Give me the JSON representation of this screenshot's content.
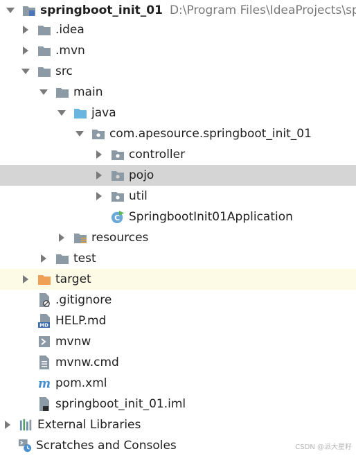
{
  "project": {
    "name": "springboot_init_01",
    "path": "D:\\Program Files\\IdeaProjects\\sp"
  },
  "tree": {
    "idea": ".idea",
    "mvn": ".mvn",
    "src": "src",
    "main": "main",
    "java": "java",
    "package": "com.apesource.springboot_init_01",
    "controller": "controller",
    "pojo": "pojo",
    "util": "util",
    "app_class": "SpringbootInit01Application",
    "resources": "resources",
    "test": "test",
    "target": "target",
    "gitignore": ".gitignore",
    "help": "HELP.md",
    "mvnw": "mvnw",
    "mvnw_cmd": "mvnw.cmd",
    "pom": "pom.xml",
    "iml": "springboot_init_01.iml",
    "external_libraries": "External Libraries",
    "scratches": "Scratches and Consoles"
  },
  "watermark": "CSDN @派大星籽",
  "colors": {
    "selection": "#d5d5d5",
    "excluded_row": "#fdfbe6",
    "folder": "#8c9aa5",
    "source_folder": "#68b6e0",
    "excluded_folder": "#f0a056"
  }
}
